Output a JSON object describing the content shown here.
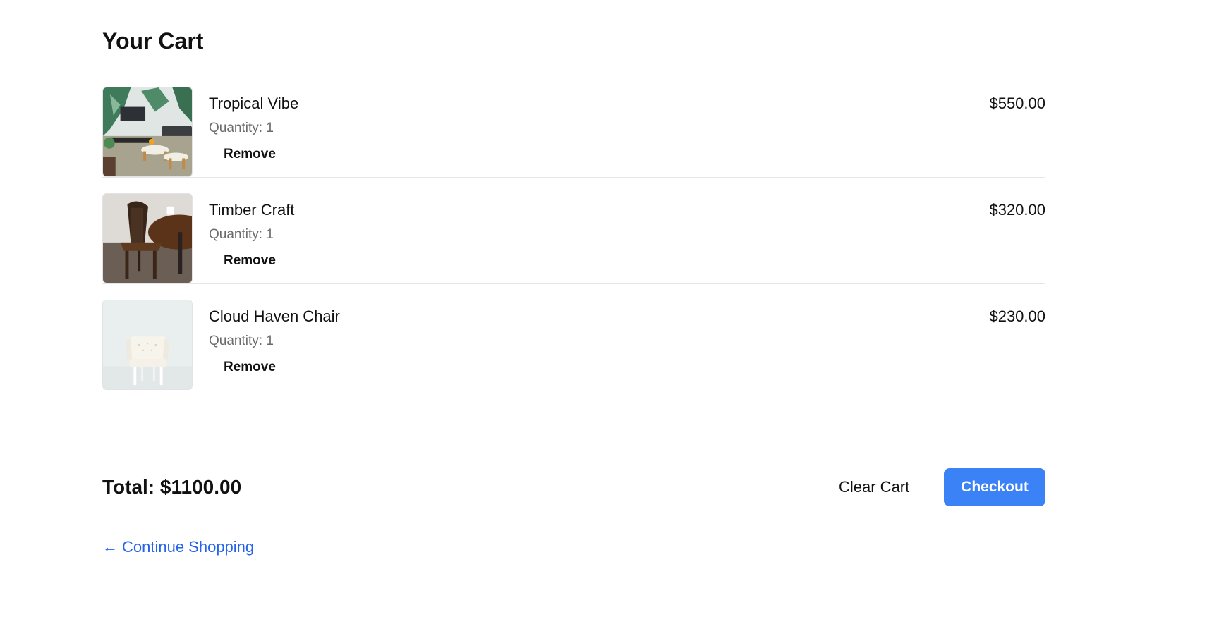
{
  "cart": {
    "title": "Your Cart",
    "quantity_label": "Quantity: ",
    "remove_label": "Remove",
    "items": [
      {
        "name": "Tropical Vibe",
        "quantity": "1",
        "price": "$550.00",
        "image_icon": "living-room-photo"
      },
      {
        "name": "Timber Craft",
        "quantity": "1",
        "price": "$320.00",
        "image_icon": "wooden-chair-photo"
      },
      {
        "name": "Cloud Haven Chair",
        "quantity": "1",
        "price": "$230.00",
        "image_icon": "white-armchair-photo"
      }
    ],
    "total_label": "Total: $1100.00",
    "clear_label": "Clear Cart",
    "checkout_label": "Checkout",
    "continue_arrow": "←",
    "continue_label": "Continue Shopping"
  },
  "colors": {
    "accent": "#3b82f6",
    "link": "#2563eb",
    "muted_text": "#6b6b6b",
    "divider": "#e6e6e6"
  }
}
